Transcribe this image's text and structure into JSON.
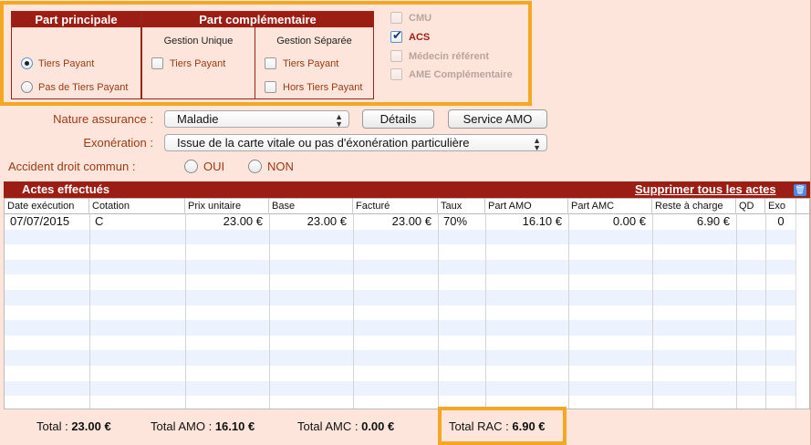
{
  "panels": {
    "principale": {
      "title": "Part principale",
      "options": [
        "Tiers Payant",
        "Pas de Tiers Payant"
      ],
      "selected": "Tiers Payant"
    },
    "complementaire": {
      "title": "Part complémentaire",
      "gestion_unique": {
        "heading": "Gestion Unique",
        "options": [
          "Tiers Payant"
        ]
      },
      "gestion_separee": {
        "heading": "Gestion Séparée",
        "options": [
          "Tiers Payant",
          "Hors Tiers Payant"
        ]
      }
    }
  },
  "side_checks": [
    {
      "label": "CMU",
      "checked": false,
      "enabled": false
    },
    {
      "label": "ACS",
      "checked": true,
      "enabled": true
    },
    {
      "label": "Médecin référent",
      "checked": false,
      "enabled": false
    },
    {
      "label": "AME Complémentaire",
      "checked": false,
      "enabled": false
    }
  ],
  "form": {
    "nature_label": "Nature assurance :",
    "nature_value": "Maladie",
    "details_button": "Détails",
    "service_amo_button": "Service AMO",
    "exoneration_label": "Exonération :",
    "exoneration_value": "Issue de la carte vitale ou pas d'éxonération particulière",
    "accident_label": "Accident droit commun :",
    "accident_options": [
      "OUI",
      "NON"
    ]
  },
  "acts": {
    "title": "Actes effectués",
    "delete_all": "Supprimer tous les actes",
    "columns": [
      "Date exécution",
      "Cotation",
      "Prix unitaire",
      "Base",
      "Facturé",
      "Taux",
      "Part AMO",
      "Part AMC",
      "Reste à charge",
      "QD",
      "Exo"
    ],
    "rows": [
      [
        "07/07/2015",
        "C",
        "23.00 €",
        "23.00 €",
        "23.00 €",
        "70%",
        "16.10 €",
        "0.00 €",
        "6.90 €",
        "",
        "0"
      ]
    ]
  },
  "totals": {
    "total_label": "Total :",
    "total_value": "23.00 €",
    "amo_label": "Total AMO :",
    "amo_value": "16.10 €",
    "amc_label": "Total AMC :",
    "amc_value": "0.00 €",
    "rac_label": "Total RAC :",
    "rac_value": "6.90 €"
  },
  "colors": {
    "accent": "#9b1d13",
    "background": "#fde5dc",
    "highlight": "#f5a623",
    "label_text": "#9b3a12"
  }
}
